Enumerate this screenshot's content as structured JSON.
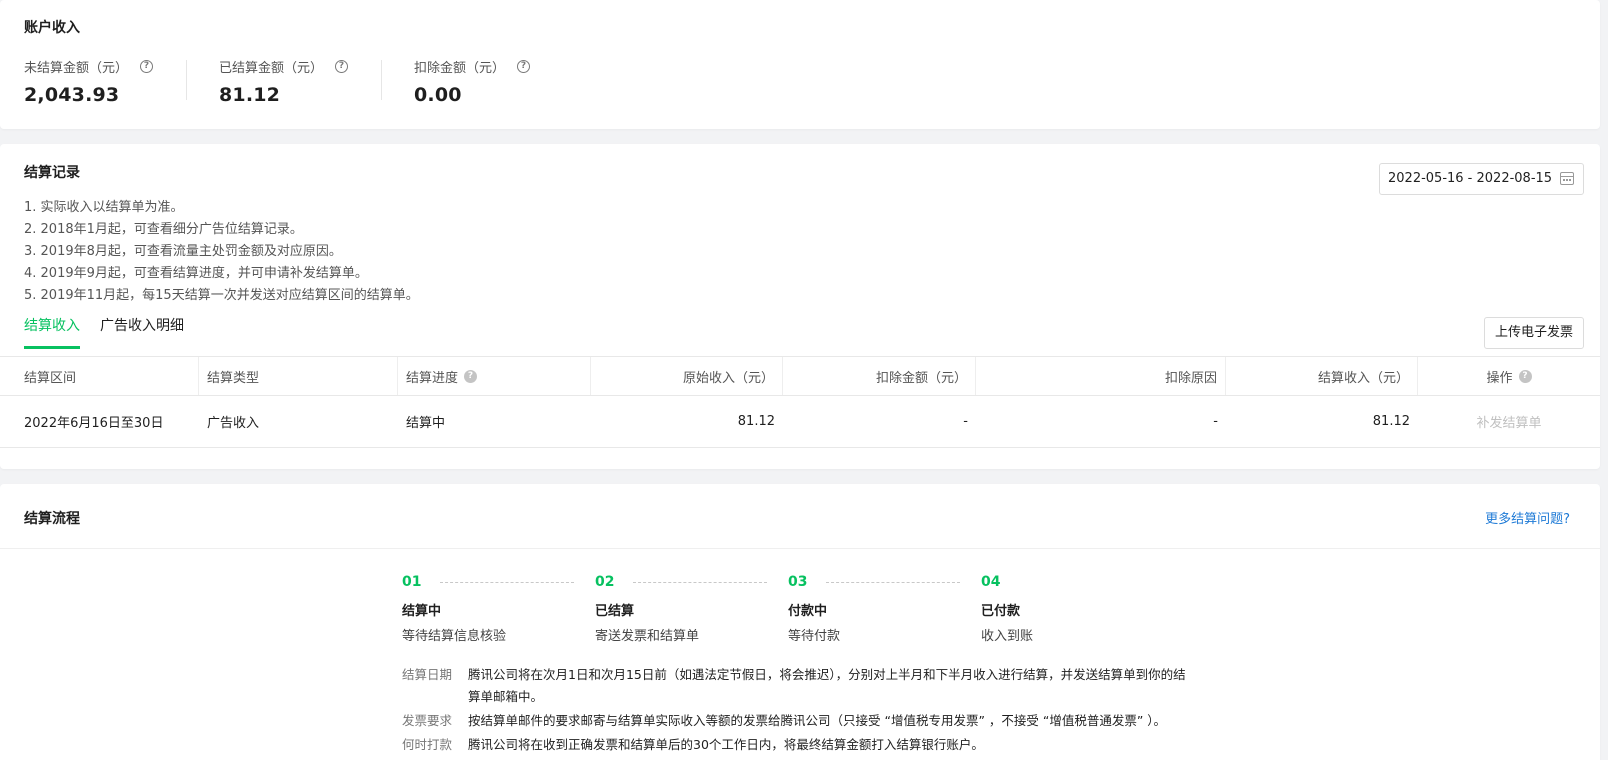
{
  "income": {
    "title": "账户收入",
    "stats": [
      {
        "label": "未结算金额（元）",
        "value": "2,043.93"
      },
      {
        "label": "已结算金额（元）",
        "value": "81.12"
      },
      {
        "label": "扣除金额（元）",
        "value": "0.00"
      }
    ],
    "help_glyph": "?"
  },
  "records": {
    "title": "结算记录",
    "date_range": "2022-05-16 - 2022-08-15",
    "notes": [
      "1. 实际收入以结算单为准。",
      "2. 2018年1月起，可查看细分广告位结算记录。",
      "3. 2019年8月起，可查看流量主处罚金额及对应原因。",
      "4. 2019年9月起，可查看结算进度，并可申请补发结算单。",
      "5. 2019年11月起，每15天结算一次并发送对应结算区间的结算单。"
    ],
    "tabs": [
      {
        "label": "结算收入",
        "active": true
      },
      {
        "label": "广告收入明细",
        "active": false
      }
    ],
    "upload_label": "上传电子发票",
    "table": {
      "headers": [
        "结算区间",
        "结算类型",
        "结算进度",
        "原始收入（元）",
        "扣除金额（元）",
        "扣除原因",
        "结算收入（元）",
        "操作"
      ],
      "rows": [
        [
          "2022年6月16日至30日",
          "广告收入",
          "结算中",
          "81.12",
          "-",
          "-",
          "81.12",
          "补发结算单"
        ]
      ]
    }
  },
  "flow": {
    "title": "结算流程",
    "more_link": "更多结算问题?",
    "steps": [
      {
        "num": "01",
        "title": "结算中",
        "desc": "等待结算信息核验"
      },
      {
        "num": "02",
        "title": "已结算",
        "desc": "寄送发票和结算单"
      },
      {
        "num": "03",
        "title": "付款中",
        "desc": "等待付款"
      },
      {
        "num": "04",
        "title": "已付款",
        "desc": "收入到账"
      }
    ],
    "rules": [
      {
        "label": "结算日期",
        "text": "腾讯公司将在次月1日和次月15日前（如遇法定节假日，将会推迟），分别对上半月和下半月收入进行结算，并发送结算单到你的结算单邮箱中。"
      },
      {
        "label": "发票要求",
        "text": "按结算单邮件的要求邮寄与结算单实际收入等额的发票给腾讯公司（只接受 “增值税专用发票” ，不接受 “增值税普通发票” ）。"
      },
      {
        "label": "何时打款",
        "text": "腾讯公司将在收到正确发票和结算单后的30个工作日内，将最终结算金额打入结算银行账户。"
      }
    ]
  },
  "colors": {
    "accent": "#07c160",
    "link": "#1e7ad6"
  }
}
